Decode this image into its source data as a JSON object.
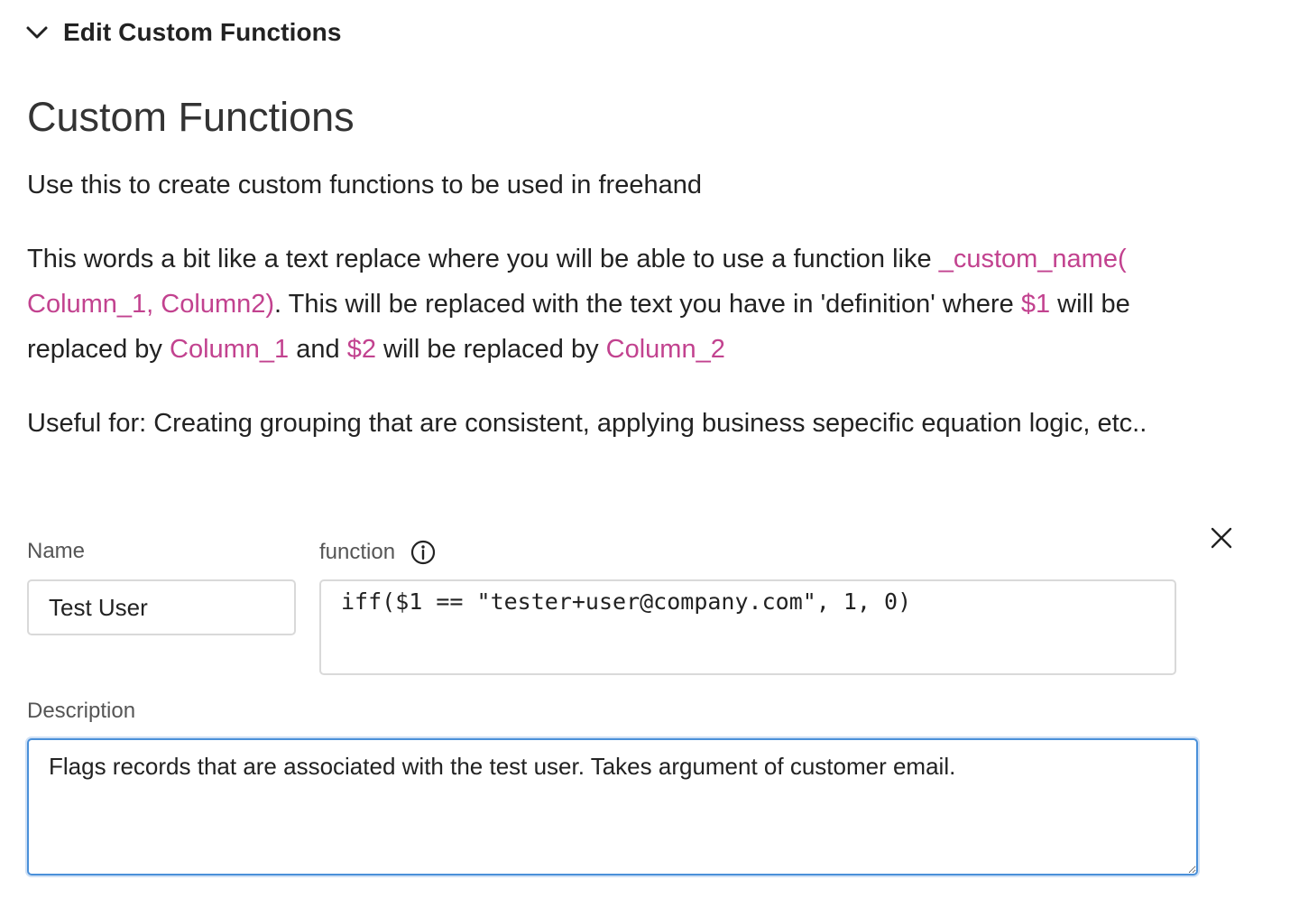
{
  "collapse": {
    "title": "Edit Custom Functions",
    "icon": "chevron-down-icon"
  },
  "section": {
    "heading": "Custom Functions",
    "intro": "Use this to create custom functions to be used in freehand",
    "explanation": {
      "t1": "This words a bit like a text replace where you will be able to use a function like ",
      "c1": "_custom_name(",
      "c2": "Column_1, Column2)",
      "t2": ". This will be replaced with the text you have in 'definition' where ",
      "c3": "$1",
      "t3": " will be replaced by ",
      "c4": "Column_1",
      "t4": " and ",
      "c5": "$2",
      "t5": " will be replaced by ",
      "c6": "Column_2"
    },
    "useful": "Useful for: Creating grouping that are consistent, applying business sepecific equation logic, etc..",
    "code_color": "#c2428f"
  },
  "form": {
    "name_label": "Name",
    "name_value": "Test User",
    "function_label": "function",
    "function_info_icon": "info-icon",
    "function_value": "iff($1 == \"tester+user@company.com\", 1, 0)",
    "close_icon": "close-icon",
    "description_label": "Description",
    "description_value": "Flags records that are associated with the test user. Takes argument of customer email.",
    "focus_color": "#4a90d9"
  }
}
